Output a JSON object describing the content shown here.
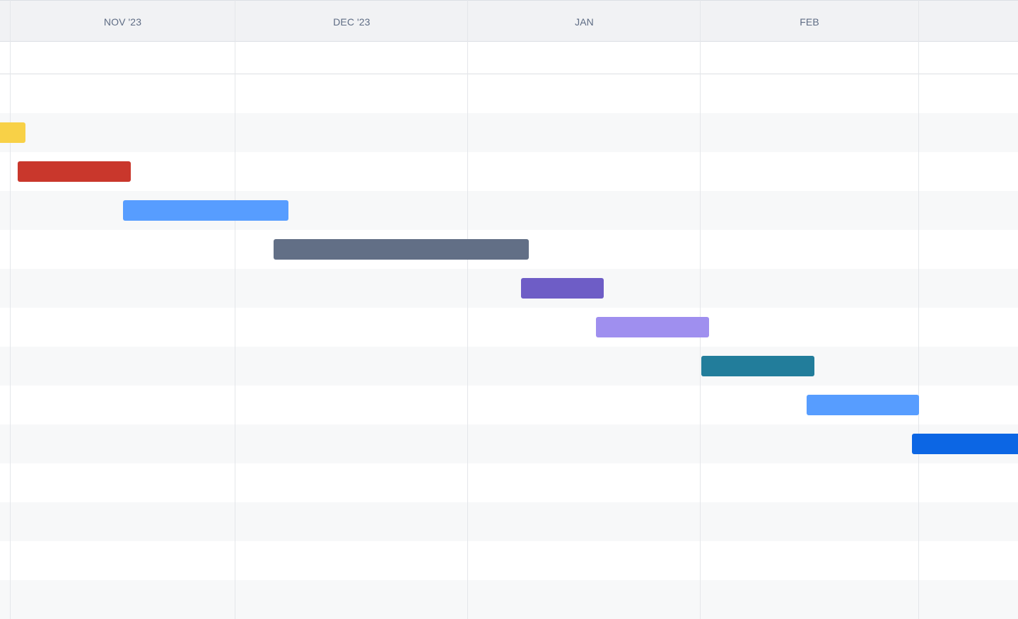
{
  "timeline": {
    "months": [
      {
        "label": "NOV '23"
      },
      {
        "label": "DEC '23"
      },
      {
        "label": "JAN"
      },
      {
        "label": "FEB"
      }
    ],
    "bars": [
      {
        "name": "timeline-bar-1",
        "color": "#f8d147"
      },
      {
        "name": "timeline-bar-2",
        "color": "#c9372c"
      },
      {
        "name": "timeline-bar-3",
        "color": "#579dff"
      },
      {
        "name": "timeline-bar-4",
        "color": "#626f86"
      },
      {
        "name": "timeline-bar-5",
        "color": "#6e5dc6"
      },
      {
        "name": "timeline-bar-6",
        "color": "#9f8fef"
      },
      {
        "name": "timeline-bar-7",
        "color": "#227d9b"
      },
      {
        "name": "timeline-bar-8",
        "color": "#579dff"
      },
      {
        "name": "timeline-bar-9",
        "color": "#0c66e4"
      }
    ]
  }
}
